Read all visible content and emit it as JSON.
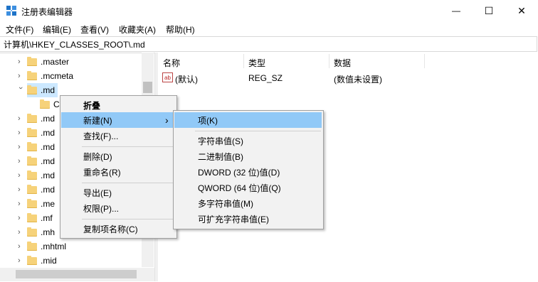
{
  "window": {
    "title": "注册表编辑器",
    "minimize_glyph": "—",
    "maximize_glyph": "☐",
    "close_glyph": "✕"
  },
  "menu": [
    "文件(F)",
    "编辑(E)",
    "查看(V)",
    "收藏夹(A)",
    "帮助(H)"
  ],
  "address": "计算机\\HKEY_CLASSES_ROOT\\.md",
  "tree": {
    "items": [
      ".master",
      ".mcmeta",
      ".md",
      "C",
      ".md",
      ".md",
      ".md",
      ".md",
      ".md",
      ".md",
      ".me",
      ".mf",
      ".mh",
      ".mhtml",
      ".mid"
    ],
    "selected_index": 2
  },
  "list": {
    "headers": [
      "名称",
      "类型",
      "数据"
    ],
    "rows": [
      {
        "name": "(默认)",
        "type": "REG_SZ",
        "data": "(数值未设置)",
        "icon": "ab"
      }
    ]
  },
  "context_menu": {
    "items": [
      "折叠",
      "新建(N)",
      "查找(F)...",
      "删除(D)",
      "重命名(R)",
      "导出(E)",
      "权限(P)...",
      "复制项名称(C)"
    ],
    "highlighted": "新建(N)",
    "submenu_arrow": "›"
  },
  "submenu": {
    "items": [
      "项(K)",
      "字符串值(S)",
      "二进制值(B)",
      "DWORD (32 位)值(D)",
      "QWORD (64 位)值(Q)",
      "多字符串值(M)",
      "可扩充字符串值(E)"
    ],
    "highlighted": "项(K)"
  },
  "icons": {
    "app": "regedit-icon",
    "ab_value": "string-value-icon",
    "folder": "folder-icon"
  },
  "colors": {
    "highlight": "#91c9f7",
    "menu_bg": "#f2f2f2",
    "folder": "#f6d27a"
  }
}
